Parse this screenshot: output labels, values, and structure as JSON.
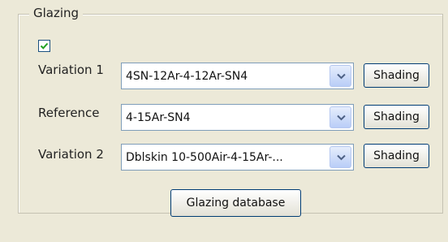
{
  "group": {
    "title": "Glazing"
  },
  "checkbox": {
    "checked": true
  },
  "rows": [
    {
      "label": "Variation 1",
      "value": "4SN-12Ar-4-12Ar-SN4",
      "button": "Shading"
    },
    {
      "label": "Reference",
      "value": "4-15Ar-SN4",
      "button": "Shading"
    },
    {
      "label": "Variation 2",
      "value": "Dblskin 10-500Air-4-15Ar-...",
      "button": "Shading"
    }
  ],
  "database_button": "Glazing database",
  "colors": {
    "checkmark": "#21a121",
    "dropdown_arrow": "#4d6185"
  },
  "icons": {
    "checkmark": "checkmark-icon",
    "dropdown": "chevron-down-icon"
  }
}
